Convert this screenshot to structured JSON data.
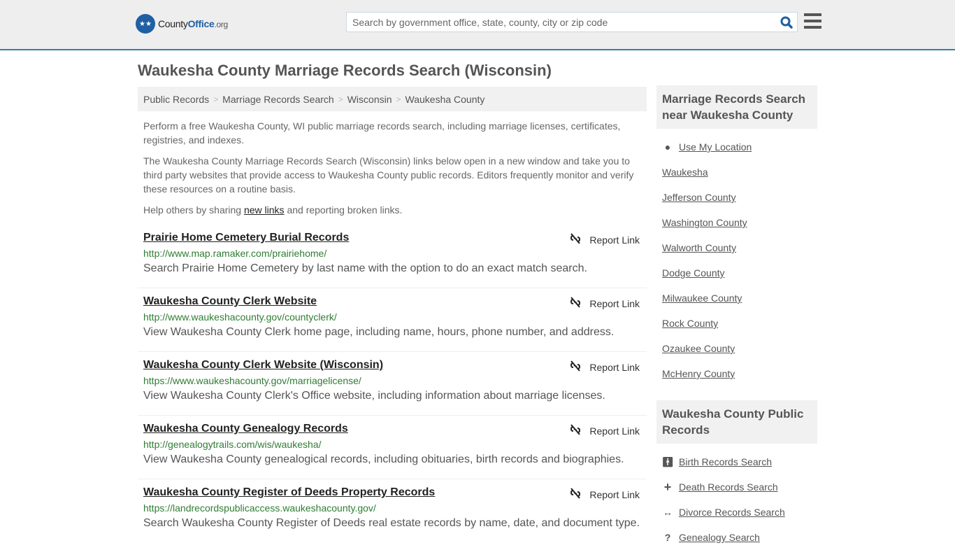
{
  "header": {
    "logo": {
      "part1": "County",
      "part2": "Office",
      "part3": ".org"
    },
    "search_placeholder": "Search by government office, state, county, city or zip code"
  },
  "page_title": "Waukesha County Marriage Records Search (Wisconsin)",
  "breadcrumb": [
    "Public Records",
    "Marriage Records Search",
    "Wisconsin",
    "Waukesha County"
  ],
  "intro": {
    "p1": "Perform a free Waukesha County, WI public marriage records search, including marriage licenses, certificates, registries, and indexes.",
    "p2": "The Waukesha County Marriage Records Search (Wisconsin) links below open in a new window and take you to third party websites that provide access to Waukesha County public records. Editors frequently monitor and verify these resources on a routine basis.",
    "p3_before": "Help others by sharing ",
    "p3_link": "new links",
    "p3_after": " and reporting broken links."
  },
  "report_label": "Report Link",
  "entries": [
    {
      "title": "Prairie Home Cemetery Burial Records",
      "url": "http://www.map.ramaker.com/prairiehome/",
      "desc": "Search Prairie Home Cemetery by last name with the option to do an exact match search."
    },
    {
      "title": "Waukesha County Clerk Website",
      "url": "http://www.waukeshacounty.gov/countyclerk/",
      "desc": "View Waukesha County Clerk home page, including name, hours, phone number, and address."
    },
    {
      "title": "Waukesha County Clerk Website (Wisconsin)",
      "url": "https://www.waukeshacounty.gov/marriagelicense/",
      "desc": "View Waukesha County Clerk's Office website, including information about marriage licenses."
    },
    {
      "title": "Waukesha County Genealogy Records",
      "url": "http://genealogytrails.com/wis/waukesha/",
      "desc": "View Waukesha County genealogical records, including obituaries, birth records and biographies."
    },
    {
      "title": "Waukesha County Register of Deeds Property Records",
      "url": "https://landrecordspublicaccess.waukeshacounty.gov/",
      "desc": "Search Waukesha County Register of Deeds real estate records by name, date, and document type."
    }
  ],
  "sidebar": {
    "nearby_title": "Marriage Records Search near Waukesha County",
    "use_location": "Use My Location",
    "nearby": [
      "Waukesha",
      "Jefferson County",
      "Washington County",
      "Walworth County",
      "Dodge County",
      "Milwaukee County",
      "Rock County",
      "Ozaukee County",
      "McHenry County"
    ],
    "public_title": "Waukesha County Public Records",
    "public": [
      {
        "icon": "person-icon",
        "label": "Birth Records Search"
      },
      {
        "icon": "plus-icon",
        "label": "Death Records Search"
      },
      {
        "icon": "arrows-icon",
        "label": "Divorce Records Search"
      },
      {
        "icon": "question-icon",
        "label": "Genealogy Search"
      }
    ]
  }
}
